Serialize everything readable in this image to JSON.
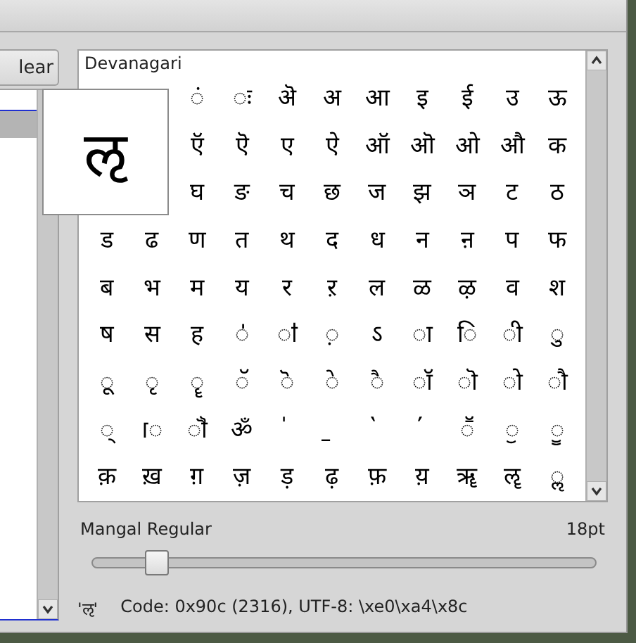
{
  "left_panel": {
    "button": "lear"
  },
  "grid": {
    "heading": "Devanagari",
    "rows": [
      [
        {},
        {},
        {
          "char": "ं"
        },
        {
          "char": "ः"
        },
        {
          "char": "ऄ"
        },
        {
          "char": "अ"
        },
        {
          "char": "आ"
        },
        {
          "char": "इ"
        },
        {
          "char": "ई"
        },
        {
          "char": "उ"
        },
        {
          "char": "ऊ"
        }
      ],
      [
        {},
        {},
        {
          "char": "ऍ"
        },
        {
          "char": "ऎ"
        },
        {
          "char": "ए"
        },
        {
          "char": "ऐ"
        },
        {
          "char": "ऑ"
        },
        {
          "char": "ऒ"
        },
        {
          "char": "ओ"
        },
        {
          "char": "औ"
        },
        {
          "char": "क"
        }
      ],
      [
        {},
        {},
        {
          "char": "घ"
        },
        {
          "char": "ङ"
        },
        {
          "char": "च"
        },
        {
          "char": "छ"
        },
        {
          "char": "ज"
        },
        {
          "char": "झ"
        },
        {
          "char": "ञ"
        },
        {
          "char": "ट"
        },
        {
          "char": "ठ"
        }
      ],
      [
        {
          "char": "ड"
        },
        {
          "char": "ढ"
        },
        {
          "char": "ण"
        },
        {
          "char": "त"
        },
        {
          "char": "थ"
        },
        {
          "char": "द"
        },
        {
          "char": "ध"
        },
        {
          "char": "न"
        },
        {
          "char": "ऩ"
        },
        {
          "char": "प"
        },
        {
          "char": "फ"
        }
      ],
      [
        {
          "char": "ब"
        },
        {
          "char": "भ"
        },
        {
          "char": "म"
        },
        {
          "char": "य"
        },
        {
          "char": "र"
        },
        {
          "char": "ऱ"
        },
        {
          "char": "ल"
        },
        {
          "char": "ळ"
        },
        {
          "char": "ऴ"
        },
        {
          "char": "व"
        },
        {
          "char": "श"
        }
      ],
      [
        {
          "char": "ष"
        },
        {
          "char": "स"
        },
        {
          "char": "ह"
        },
        {
          "char": "ऺ"
        },
        {
          "char": "ऻ"
        },
        {
          "char": "़"
        },
        {
          "char": "ऽ"
        },
        {
          "char": "ा"
        },
        {
          "char": "ि"
        },
        {
          "char": "ी"
        },
        {
          "char": "ु"
        }
      ],
      [
        {
          "char": "ू"
        },
        {
          "char": "ृ"
        },
        {
          "char": "ॄ"
        },
        {
          "char": "ॅ"
        },
        {
          "char": "ॆ"
        },
        {
          "char": "े"
        },
        {
          "char": "ै"
        },
        {
          "char": "ॉ"
        },
        {
          "char": "ॊ"
        },
        {
          "char": "ो"
        },
        {
          "char": "ौ"
        }
      ],
      [
        {
          "char": "्"
        },
        {
          "char": "ॎ"
        },
        {
          "char": "ॏ"
        },
        {
          "char": "ॐ"
        },
        {
          "char": "॑"
        },
        {
          "char": "॒"
        },
        {
          "char": "॓"
        },
        {
          "char": "॔"
        },
        {
          "char": "ॕ"
        },
        {
          "char": "ॖ"
        },
        {
          "char": "ॗ"
        }
      ],
      [
        {
          "char": "क़"
        },
        {
          "char": "ख़"
        },
        {
          "char": "ग़"
        },
        {
          "char": "ज़"
        },
        {
          "char": "ड़"
        },
        {
          "char": "ढ़"
        },
        {
          "char": "फ़"
        },
        {
          "char": "य़"
        },
        {
          "char": "ॠ"
        },
        {
          "char": "ॡ"
        },
        {
          "char": "ॢ"
        }
      ]
    ],
    "preview": "ऌ"
  },
  "font": {
    "name": "Mangal Regular",
    "size": "18pt",
    "level": 0.125
  },
  "status": {
    "char": "'ऌ'",
    "info": "Code: 0x90c (2316), UTF-8: \\xe0\\xa4\\x8c"
  }
}
